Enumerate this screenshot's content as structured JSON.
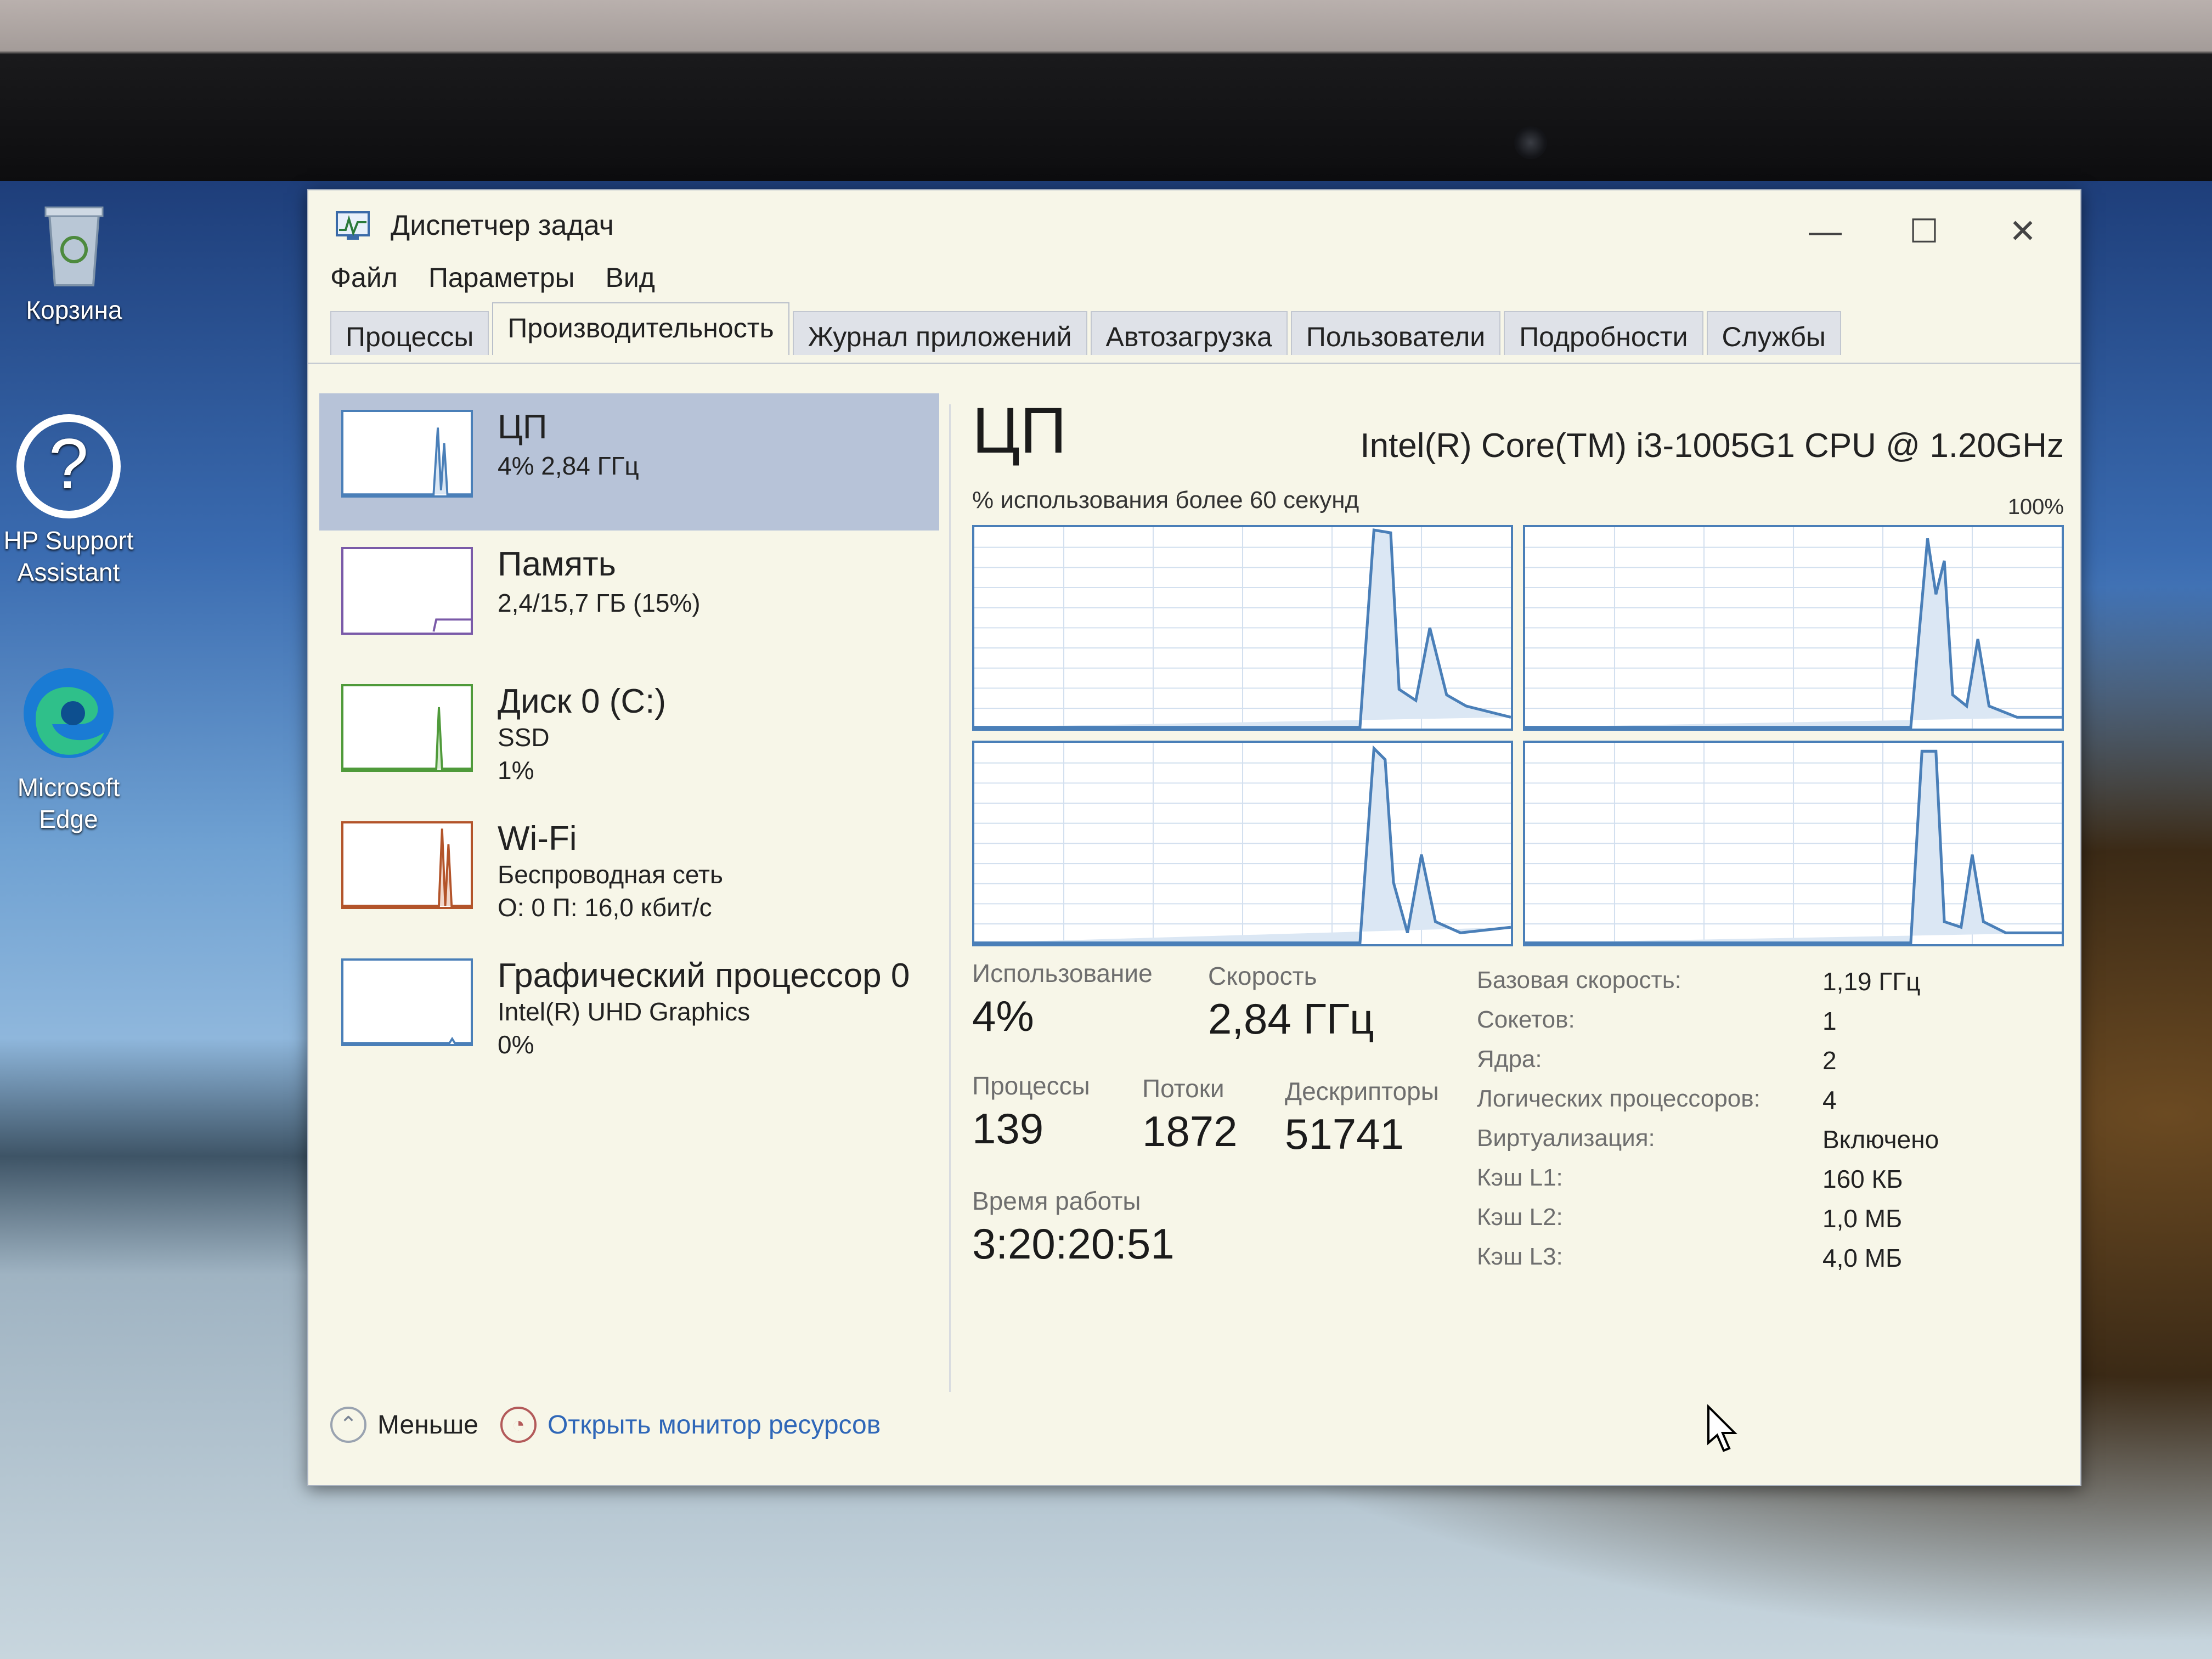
{
  "desktop": {
    "icons": [
      {
        "label": "Корзина",
        "icon": "recycle-bin-icon"
      },
      {
        "label": "HP Support Assistant",
        "icon": "help-icon"
      },
      {
        "label": "Microsoft Edge",
        "icon": "edge-icon"
      }
    ]
  },
  "window": {
    "title": "Диспетчер задач",
    "menu": [
      "Файл",
      "Параметры",
      "Вид"
    ],
    "tabs": [
      "Процессы",
      "Производительность",
      "Журнал приложений",
      "Автозагрузка",
      "Пользователи",
      "Подробности",
      "Службы"
    ],
    "active_tab": "Производительность",
    "controls": {
      "minimize": "—",
      "maximize": "☐",
      "close": "✕"
    }
  },
  "sidebar": {
    "items": [
      {
        "title": "ЦП",
        "line1": "4% 2,84 ГГц",
        "line2": "",
        "accent": "#4a7fb8"
      },
      {
        "title": "Память",
        "line1": "2,4/15,7 ГБ (15%)",
        "line2": "",
        "accent": "#7a5aa8"
      },
      {
        "title": "Диск 0 (C:)",
        "line1": "SSD",
        "line2": "1%",
        "accent": "#4f9a3a"
      },
      {
        "title": "Wi-Fi",
        "line1": "Беспроводная сеть",
        "line2": "О: 0 П: 16,0 кбит/с",
        "accent": "#b3542a"
      },
      {
        "title": "Графический процессор 0",
        "line1": "Intel(R) UHD Graphics",
        "line2": "0%",
        "accent": "#4a7fb8"
      }
    ]
  },
  "main": {
    "heading": "ЦП",
    "model": "Intel(R) Core(TM) i3-1005G1 CPU @ 1.20GHz",
    "graph_caption": "% использования более 60 секунд",
    "graph_max": "100%",
    "stats": {
      "usage_label": "Использование",
      "usage_value": "4%",
      "speed_label": "Скорость",
      "speed_value": "2,84 ГГц",
      "processes_label": "Процессы",
      "processes_value": "139",
      "threads_label": "Потоки",
      "threads_value": "1872",
      "handles_label": "Дескрипторы",
      "handles_value": "51741",
      "uptime_label": "Время работы",
      "uptime_value": "3:20:20:51"
    },
    "specs": [
      {
        "label": "Базовая скорость:",
        "value": "1,19 ГГц"
      },
      {
        "label": "Сокетов:",
        "value": "1"
      },
      {
        "label": "Ядра:",
        "value": "2"
      },
      {
        "label": "Логических процессоров:",
        "value": "4"
      },
      {
        "label": "Виртуализация:",
        "value": "Включено"
      },
      {
        "label": "Кэш L1:",
        "value": "160 КБ"
      },
      {
        "label": "Кэш L2:",
        "value": "1,0 МБ"
      },
      {
        "label": "Кэш L3:",
        "value": "4,0 МБ"
      }
    ]
  },
  "footer": {
    "less_label": "Меньше",
    "monitor_label": "Открыть монитор ресурсов"
  },
  "colors": {
    "cpu_line": "#4a7fb8",
    "selection": "#b7c3d8",
    "link": "#2f67b8"
  }
}
